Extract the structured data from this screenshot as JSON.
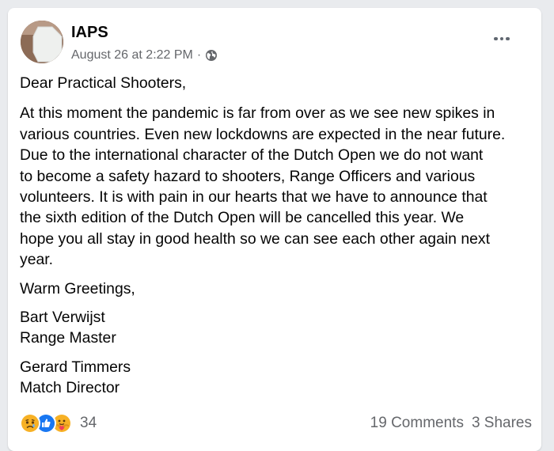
{
  "post": {
    "author": "IAPS",
    "timestamp": "August 26 at 2:22 PM",
    "separator": "·",
    "privacy_icon": "globe-icon",
    "more_icon": "more-options-icon",
    "greeting": "Dear Practical Shooters,",
    "body_lines": [
      "At this moment the pandemic is far from over as we see new spikes in",
      "various countries. Even new lockdowns are expected in the near future.",
      "Due to the international character of the Dutch Open we do not want",
      "to become a safety hazard to shooters, Range Officers and various",
      "volunteers. It is with pain in our hearts that we have to announce that",
      "the sixth edition of the Dutch Open will be cancelled this year. We",
      "hope you all stay in good health so we can see each other again next",
      "year."
    ],
    "closing": "Warm Greetings,",
    "signature1_name": "Bart Verwijst",
    "signature1_title": "Range Master",
    "signature2_name": "Gerard Timmers",
    "signature2_title": "Match Director"
  },
  "footer": {
    "reaction_icons": [
      "sad-reaction-icon",
      "like-reaction-icon",
      "care-reaction-icon"
    ],
    "reaction_count": "34",
    "comments": "19 Comments",
    "shares": "3 Shares"
  },
  "colors": {
    "text_primary": "#050505",
    "text_secondary": "#65676b",
    "like_blue": "#1877f2",
    "reaction_yellow": "#f7b125"
  }
}
